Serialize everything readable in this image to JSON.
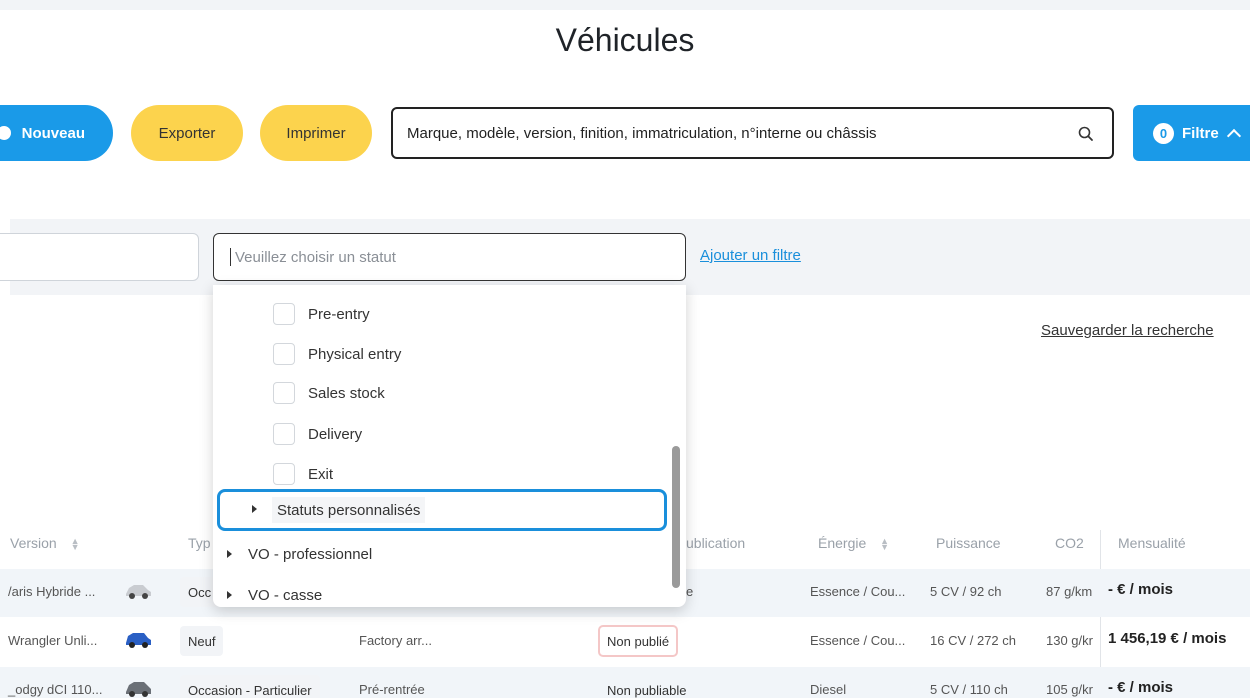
{
  "page": {
    "title": "Véhicules"
  },
  "toolbar": {
    "new_label": "Nouveau",
    "export_label": "Exporter",
    "print_label": "Imprimer",
    "search_placeholder": "Marque, modèle, version, finition, immatriculation, n°interne ou châssis",
    "filter_count": "0",
    "filter_label": "Filtre"
  },
  "filters": {
    "status_placeholder": "Veuillez choisir un statut",
    "add_filter_label": "Ajouter un filtre",
    "save_search_label": "Sauvegarder la recherche"
  },
  "dropdown": {
    "options": [
      "Pre-entry",
      "Physical entry",
      "Sales stock",
      "Delivery",
      "Exit"
    ],
    "groups": [
      "Statuts personnalisés",
      "VO - professionnel",
      "VO - casse"
    ]
  },
  "table": {
    "headers": {
      "version": "Version",
      "type": "Typ",
      "publication": "ublication",
      "energie": "Énergie",
      "puissance": "Puissance",
      "co2": "CO2",
      "mensualite": "Mensualité"
    },
    "rows": [
      {
        "version": "/aris Hybride ...",
        "type": "Occ",
        "status": "",
        "publication": "e",
        "energie": "Essence / Cou...",
        "puissance": "5 CV / 92 ch",
        "co2": "87 g/km",
        "mensualite": "- € / mois"
      },
      {
        "version": "Wrangler Unli...",
        "type": "Neuf",
        "status": "Factory arr...",
        "publication": "Non publié",
        "energie": "Essence / Cou...",
        "puissance": "16 CV / 272 ch",
        "co2": "130 g/kr",
        "mensualite": "1 456,19 € / mois"
      },
      {
        "version": "_odgy dCI 110...",
        "type": "Occasion - Particulier",
        "status": "Pré-rentrée",
        "publication": "Non publiable",
        "energie": "Diesel",
        "puissance": "5 CV / 110 ch",
        "co2": "105 g/kr",
        "mensualite": "- € / mois"
      }
    ]
  },
  "colors": {
    "primary": "#1a9ae8",
    "accent": "#fcd34d",
    "band": "#f2f4f7"
  }
}
